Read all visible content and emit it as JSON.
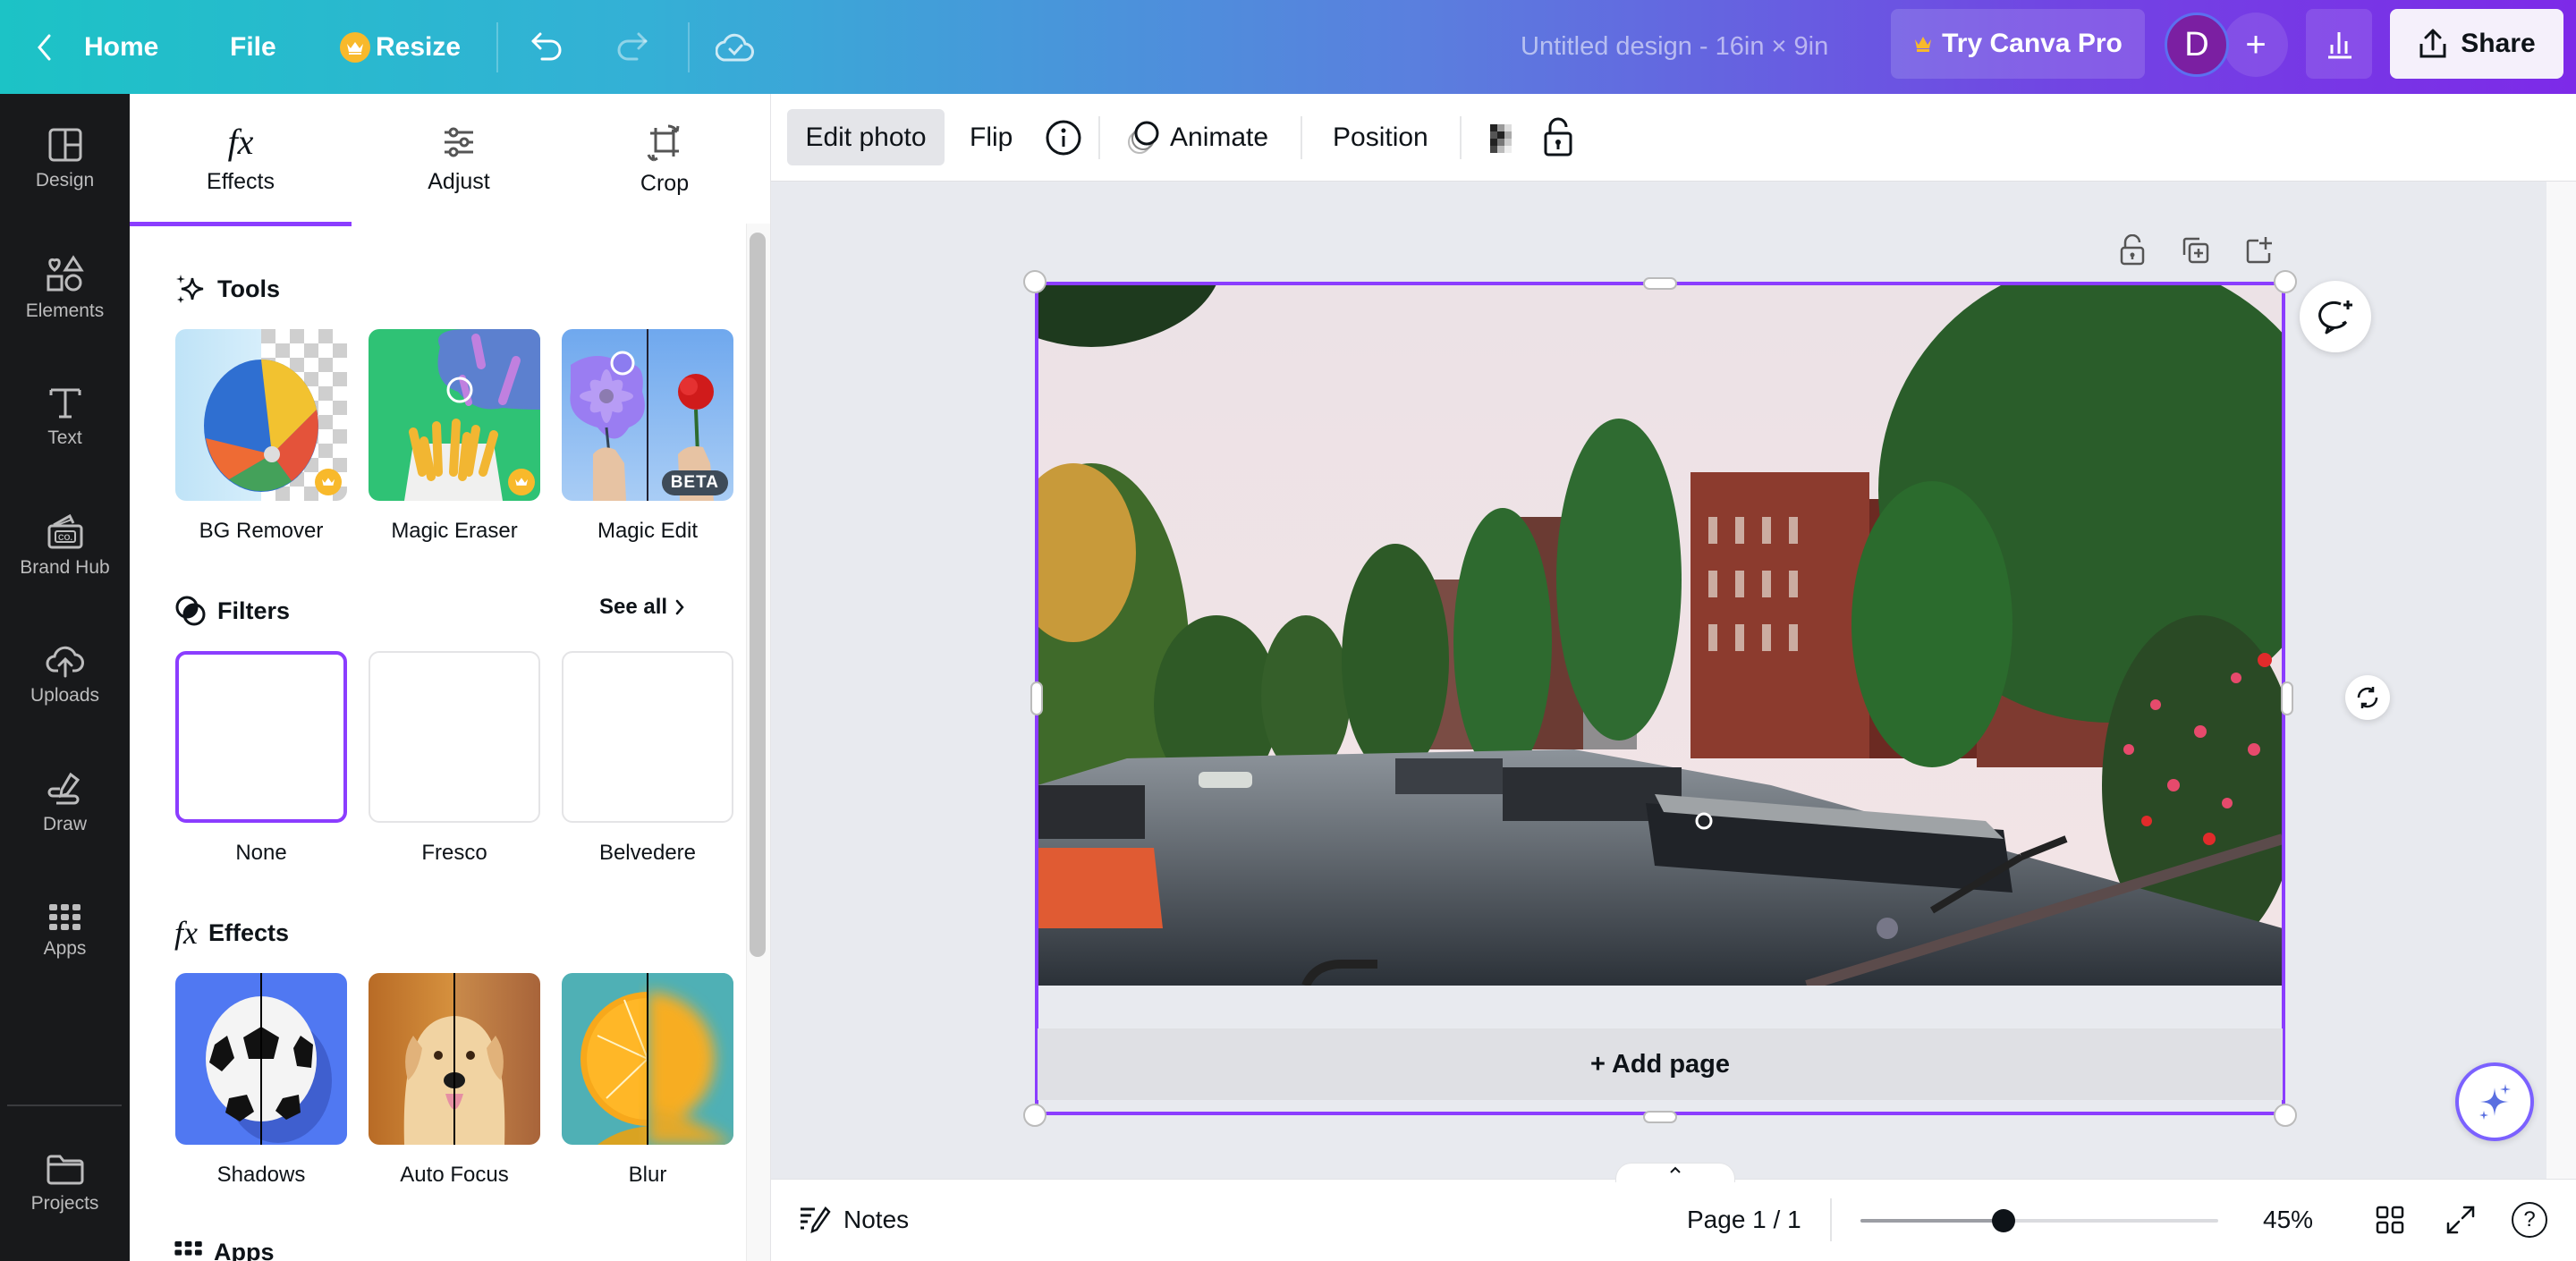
{
  "topbar": {
    "back_icon": "chevron-left-icon",
    "home_label": "Home",
    "file_label": "File",
    "resize_label": "Resize",
    "resize_badge_icon": "crown-icon",
    "undo_icon": "undo-icon",
    "redo_icon": "redo-icon",
    "cloud_icon": "cloud-saved-icon",
    "doc_title": "Untitled design - 16in × 9in",
    "try_pro_label": "Try Canva Pro",
    "avatar_initial": "D",
    "add_member_label": "+",
    "insights_icon": "bar-chart-icon",
    "share_label": "Share",
    "share_icon": "share-upload-icon"
  },
  "rail": {
    "items": [
      {
        "label": "Design",
        "icon": "layout-icon"
      },
      {
        "label": "Elements",
        "icon": "shapes-icon"
      },
      {
        "label": "Text",
        "icon": "text-icon"
      },
      {
        "label": "Brand Hub",
        "icon": "brand-kit-icon"
      },
      {
        "label": "Uploads",
        "icon": "cloud-upload-icon"
      },
      {
        "label": "Draw",
        "icon": "pen-icon"
      },
      {
        "label": "Apps",
        "icon": "apps-grid-icon"
      },
      {
        "label": "Projects",
        "icon": "folder-icon"
      }
    ]
  },
  "panel": {
    "tabs": [
      {
        "label": "Effects",
        "icon": "fx-icon",
        "active": true
      },
      {
        "label": "Adjust",
        "icon": "sliders-icon",
        "active": false
      },
      {
        "label": "Crop",
        "icon": "crop-rotate-icon",
        "active": false
      }
    ],
    "tools": {
      "title": "Tools",
      "items": [
        {
          "label": "BG Remover",
          "badge": "crown"
        },
        {
          "label": "Magic Eraser",
          "badge": "crown"
        },
        {
          "label": "Magic Edit",
          "badge": "BETA"
        }
      ]
    },
    "filters": {
      "title": "Filters",
      "see_all": "See all",
      "items": [
        {
          "label": "None",
          "selected": true
        },
        {
          "label": "Fresco",
          "selected": false
        },
        {
          "label": "Belvedere",
          "selected": false
        }
      ]
    },
    "effects": {
      "title": "Effects",
      "items": [
        {
          "label": "Shadows"
        },
        {
          "label": "Auto Focus"
        },
        {
          "label": "Blur"
        }
      ]
    },
    "apps": {
      "title": "Apps"
    }
  },
  "context_toolbar": {
    "edit_photo": "Edit photo",
    "flip": "Flip",
    "info_icon": "info-icon",
    "animate": "Animate",
    "position": "Position",
    "transparency_icon": "transparency-icon",
    "lock_icon": "unlock-icon"
  },
  "canvas": {
    "add_page_label": "+ Add page",
    "page_actions": [
      "unlock-icon",
      "duplicate-page-icon",
      "add-page-icon"
    ],
    "comment_icon": "add-comment-icon",
    "rotate_icon": "rotate-icon",
    "magic_icon": "sparkle-icon",
    "selection_color": "#8b3dff"
  },
  "footer": {
    "notes_label": "Notes",
    "page_indicator": "Page 1 / 1",
    "zoom_percent": "45%",
    "zoom_slider_fraction": 0.4,
    "grid_icon": "grid-view-icon",
    "fullscreen_icon": "fullscreen-icon",
    "help_label": "?"
  }
}
